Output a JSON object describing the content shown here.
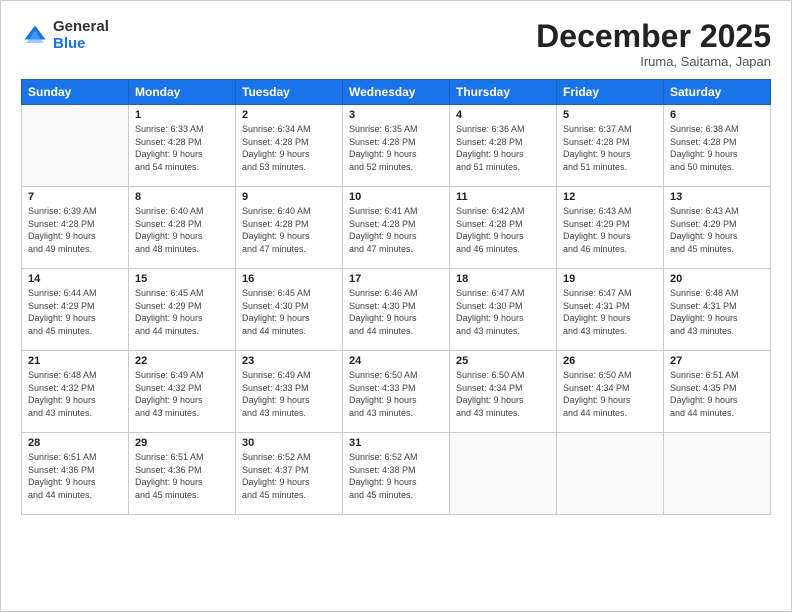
{
  "logo": {
    "general": "General",
    "blue": "Blue"
  },
  "header": {
    "month": "December 2025",
    "location": "Iruma, Saitama, Japan"
  },
  "weekdays": [
    "Sunday",
    "Monday",
    "Tuesday",
    "Wednesday",
    "Thursday",
    "Friday",
    "Saturday"
  ],
  "weeks": [
    [
      {
        "day": "",
        "info": ""
      },
      {
        "day": "1",
        "info": "Sunrise: 6:33 AM\nSunset: 4:28 PM\nDaylight: 9 hours\nand 54 minutes."
      },
      {
        "day": "2",
        "info": "Sunrise: 6:34 AM\nSunset: 4:28 PM\nDaylight: 9 hours\nand 53 minutes."
      },
      {
        "day": "3",
        "info": "Sunrise: 6:35 AM\nSunset: 4:28 PM\nDaylight: 9 hours\nand 52 minutes."
      },
      {
        "day": "4",
        "info": "Sunrise: 6:36 AM\nSunset: 4:28 PM\nDaylight: 9 hours\nand 51 minutes."
      },
      {
        "day": "5",
        "info": "Sunrise: 6:37 AM\nSunset: 4:28 PM\nDaylight: 9 hours\nand 51 minutes."
      },
      {
        "day": "6",
        "info": "Sunrise: 6:38 AM\nSunset: 4:28 PM\nDaylight: 9 hours\nand 50 minutes."
      }
    ],
    [
      {
        "day": "7",
        "info": "Sunrise: 6:39 AM\nSunset: 4:28 PM\nDaylight: 9 hours\nand 49 minutes."
      },
      {
        "day": "8",
        "info": "Sunrise: 6:40 AM\nSunset: 4:28 PM\nDaylight: 9 hours\nand 48 minutes."
      },
      {
        "day": "9",
        "info": "Sunrise: 6:40 AM\nSunset: 4:28 PM\nDaylight: 9 hours\nand 47 minutes."
      },
      {
        "day": "10",
        "info": "Sunrise: 6:41 AM\nSunset: 4:28 PM\nDaylight: 9 hours\nand 47 minutes."
      },
      {
        "day": "11",
        "info": "Sunrise: 6:42 AM\nSunset: 4:28 PM\nDaylight: 9 hours\nand 46 minutes."
      },
      {
        "day": "12",
        "info": "Sunrise: 6:43 AM\nSunset: 4:29 PM\nDaylight: 9 hours\nand 46 minutes."
      },
      {
        "day": "13",
        "info": "Sunrise: 6:43 AM\nSunset: 4:29 PM\nDaylight: 9 hours\nand 45 minutes."
      }
    ],
    [
      {
        "day": "14",
        "info": "Sunrise: 6:44 AM\nSunset: 4:29 PM\nDaylight: 9 hours\nand 45 minutes."
      },
      {
        "day": "15",
        "info": "Sunrise: 6:45 AM\nSunset: 4:29 PM\nDaylight: 9 hours\nand 44 minutes."
      },
      {
        "day": "16",
        "info": "Sunrise: 6:45 AM\nSunset: 4:30 PM\nDaylight: 9 hours\nand 44 minutes."
      },
      {
        "day": "17",
        "info": "Sunrise: 6:46 AM\nSunset: 4:30 PM\nDaylight: 9 hours\nand 44 minutes."
      },
      {
        "day": "18",
        "info": "Sunrise: 6:47 AM\nSunset: 4:30 PM\nDaylight: 9 hours\nand 43 minutes."
      },
      {
        "day": "19",
        "info": "Sunrise: 6:47 AM\nSunset: 4:31 PM\nDaylight: 9 hours\nand 43 minutes."
      },
      {
        "day": "20",
        "info": "Sunrise: 6:48 AM\nSunset: 4:31 PM\nDaylight: 9 hours\nand 43 minutes."
      }
    ],
    [
      {
        "day": "21",
        "info": "Sunrise: 6:48 AM\nSunset: 4:32 PM\nDaylight: 9 hours\nand 43 minutes."
      },
      {
        "day": "22",
        "info": "Sunrise: 6:49 AM\nSunset: 4:32 PM\nDaylight: 9 hours\nand 43 minutes."
      },
      {
        "day": "23",
        "info": "Sunrise: 6:49 AM\nSunset: 4:33 PM\nDaylight: 9 hours\nand 43 minutes."
      },
      {
        "day": "24",
        "info": "Sunrise: 6:50 AM\nSunset: 4:33 PM\nDaylight: 9 hours\nand 43 minutes."
      },
      {
        "day": "25",
        "info": "Sunrise: 6:50 AM\nSunset: 4:34 PM\nDaylight: 9 hours\nand 43 minutes."
      },
      {
        "day": "26",
        "info": "Sunrise: 6:50 AM\nSunset: 4:34 PM\nDaylight: 9 hours\nand 44 minutes."
      },
      {
        "day": "27",
        "info": "Sunrise: 6:51 AM\nSunset: 4:35 PM\nDaylight: 9 hours\nand 44 minutes."
      }
    ],
    [
      {
        "day": "28",
        "info": "Sunrise: 6:51 AM\nSunset: 4:36 PM\nDaylight: 9 hours\nand 44 minutes."
      },
      {
        "day": "29",
        "info": "Sunrise: 6:51 AM\nSunset: 4:36 PM\nDaylight: 9 hours\nand 45 minutes."
      },
      {
        "day": "30",
        "info": "Sunrise: 6:52 AM\nSunset: 4:37 PM\nDaylight: 9 hours\nand 45 minutes."
      },
      {
        "day": "31",
        "info": "Sunrise: 6:52 AM\nSunset: 4:38 PM\nDaylight: 9 hours\nand 45 minutes."
      },
      {
        "day": "",
        "info": ""
      },
      {
        "day": "",
        "info": ""
      },
      {
        "day": "",
        "info": ""
      }
    ]
  ]
}
